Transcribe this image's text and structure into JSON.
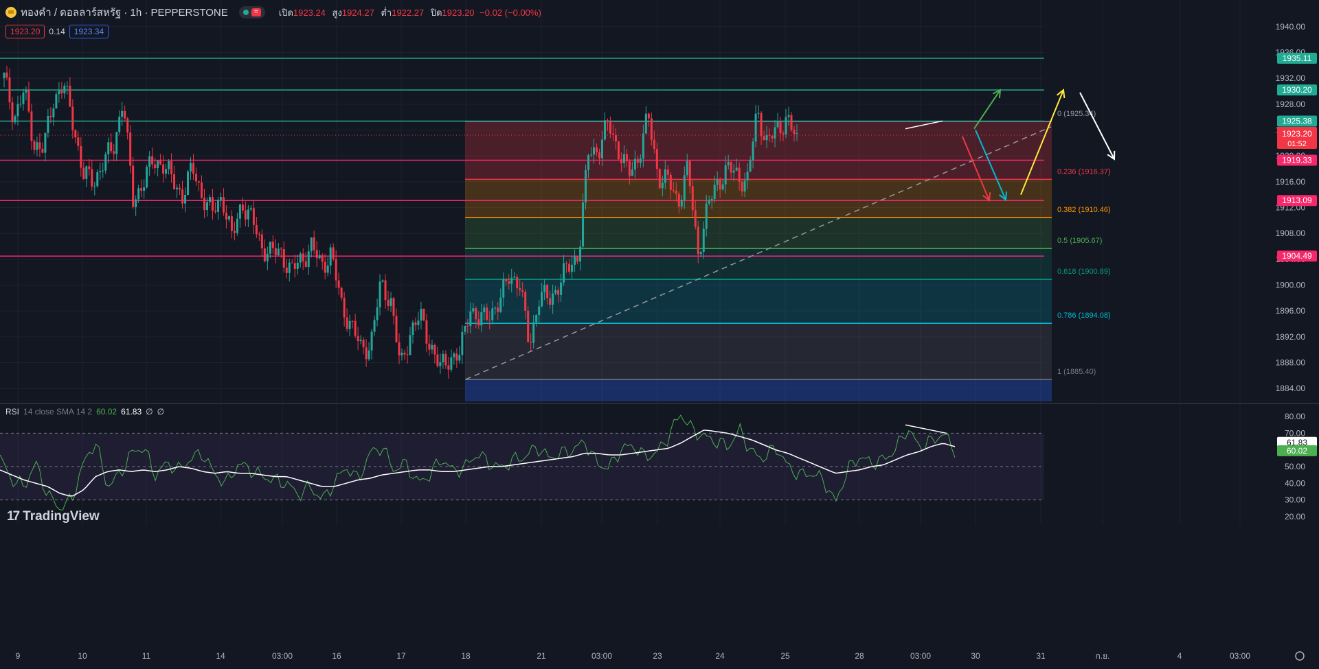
{
  "header": {
    "symbol": "ทองคำ / ดอลลาร์สหรัฐ · 1h · PEPPERSTONE",
    "open_label": "เปิด",
    "open": "1923.24",
    "high_label": "สูง",
    "high": "1924.27",
    "low_label": "ต่ำ",
    "low": "1922.27",
    "close_label": "ปิด",
    "close": "1923.20",
    "change": "−0.02 (−0.00%)",
    "sell": "1923.20",
    "spread": "0.14",
    "buy": "1923.34",
    "status_icon": "green-dot-icon",
    "badge_icon": "equals-icon",
    "badge_text": "="
  },
  "rsi_legend": {
    "name": "RSI",
    "params": "14 close SMA 14 2",
    "value1": "60.02",
    "value2": "61.83",
    "empty1": "∅",
    "empty2": "∅"
  },
  "logo": {
    "text": "TradingView",
    "mark": "17"
  },
  "colors": {
    "bg": "#131722",
    "up": "#26a69a",
    "down": "#f23645",
    "grid": "#1e222d",
    "text": "#b2b5be"
  },
  "chart_data": [
    {
      "type": "candlestick",
      "title": "ทองคำ / ดอลลาร์สหรัฐ · 1h · PEPPERSTONE",
      "ylim": [
        1882,
        1942
      ],
      "y_ticks": [
        "1884.00",
        "1888.00",
        "1892.00",
        "1896.00",
        "1900.00",
        "1904.00",
        "1908.00",
        "1912.00",
        "1916.00",
        "1920.00",
        "1924.00",
        "1928.00",
        "1932.00",
        "1936.00",
        "1940.00"
      ],
      "x_ticks": [
        "9",
        "10",
        "11",
        "14",
        "03:00",
        "16",
        "17",
        "18",
        "21",
        "03:00",
        "23",
        "24",
        "25",
        "28",
        "03:00",
        "30",
        "31",
        "ก.ย.",
        "4",
        "03:00"
      ],
      "price_path": [
        1932,
        1926,
        1930,
        1922,
        1921,
        1929,
        1931,
        1925,
        1917,
        1916,
        1919,
        1921,
        1929,
        1913,
        1916,
        1919,
        1919,
        1916,
        1914,
        1918,
        1914,
        1911,
        1914,
        1907,
        1913,
        1910,
        1906,
        1905,
        1905,
        1902,
        1904,
        1906,
        1903,
        1905,
        1897,
        1894,
        1890,
        1891,
        1900,
        1898,
        1887,
        1893,
        1895,
        1891,
        1887,
        1889,
        1889,
        1897,
        1894,
        1896,
        1897,
        1902,
        1900,
        1891,
        1898,
        1898,
        1900,
        1903,
        1905,
        1921,
        1921,
        1925,
        1921,
        1917,
        1920,
        1926,
        1917,
        1916,
        1913,
        1918,
        1905,
        1912,
        1916,
        1918,
        1917,
        1916,
        1927,
        1922,
        1924,
        1926,
        1922
      ],
      "current_price": "1923.20",
      "countdown": "01:52",
      "horizontal_levels": [
        {
          "price": 1935.11,
          "label": "1935.11",
          "color": "#22ab94"
        },
        {
          "price": 1930.2,
          "label": "1930.20",
          "color": "#22ab94"
        },
        {
          "price": 1925.38,
          "label": "1925.38",
          "color": "#22ab94"
        },
        {
          "price": 1919.33,
          "label": "1919.33",
          "color": "#f7276b"
        },
        {
          "price": 1913.09,
          "label": "1913.09",
          "color": "#f7276b"
        },
        {
          "price": 1904.49,
          "label": "1904.49",
          "color": "#f7276b"
        }
      ],
      "fibonacci": [
        {
          "level": "0",
          "price": 1925.34,
          "label": "0 (1925.34)",
          "color": "#9598a1"
        },
        {
          "level": "0.236",
          "price": 1916.37,
          "label": "0.236 (1916.37)",
          "color": "#f23645"
        },
        {
          "level": "0.382",
          "price": 1910.46,
          "label": "0.382 (1910.46)",
          "color": "#ff9800"
        },
        {
          "level": "0.5",
          "price": 1905.67,
          "label": "0.5 (1905.67)",
          "color": "#4caf50"
        },
        {
          "level": "0.618",
          "price": 1900.89,
          "label": "0.618 (1900.89)",
          "color": "#089981"
        },
        {
          "level": "0.786",
          "price": 1894.08,
          "label": "0.786 (1894.08)",
          "color": "#00bcd4"
        },
        {
          "level": "1",
          "price": 1885.4,
          "label": "1 (1885.40)",
          "color": "#787b86"
        }
      ]
    },
    {
      "type": "line",
      "title": "RSI 14 close SMA 14 2",
      "ylim": [
        15,
        85
      ],
      "y_ticks": [
        "20.00",
        "30.00",
        "40.00",
        "50.00",
        "60.00",
        "70.00",
        "80.00"
      ],
      "bands": [
        30,
        50,
        70
      ],
      "series": [
        {
          "name": "RSI",
          "color": "#4caf50",
          "values": [
            55,
            42,
            38,
            52,
            33,
            25,
            30,
            52,
            65,
            38,
            45,
            58,
            62,
            45,
            52,
            48,
            55,
            58,
            45,
            40,
            52,
            48,
            44,
            42,
            40,
            33,
            38,
            30,
            40,
            50,
            42,
            58,
            62,
            48,
            52,
            40,
            45,
            55,
            47,
            50,
            58,
            52,
            49,
            54,
            56,
            62,
            55,
            58,
            60,
            65,
            52,
            49,
            60,
            63,
            56,
            58,
            68,
            82,
            72,
            68,
            65,
            62,
            72,
            58,
            55,
            62,
            50,
            45,
            46,
            42,
            28,
            48,
            56,
            52,
            54,
            60,
            73,
            62,
            65,
            70,
            60
          ]
        },
        {
          "name": "RSI-based MA",
          "color": "#ffffff",
          "values": [
            48,
            45,
            42,
            40,
            38,
            34,
            32,
            36,
            44,
            47,
            48,
            47,
            48,
            47,
            48,
            50,
            49,
            47,
            46,
            47,
            46,
            46,
            45,
            44,
            44,
            42,
            40,
            38,
            38,
            40,
            42,
            43,
            45,
            46,
            47,
            48,
            48,
            47,
            47,
            48,
            49,
            50,
            50,
            51,
            52,
            53,
            54,
            55,
            56,
            58,
            58,
            57,
            57,
            58,
            59,
            60,
            61,
            64,
            68,
            72,
            71,
            70,
            68,
            66,
            63,
            60,
            58,
            55,
            52,
            49,
            46,
            47,
            48,
            50,
            51,
            54,
            57,
            59,
            62,
            64,
            62
          ]
        }
      ],
      "last_values": [
        {
          "label": "61.83",
          "color": "#ffffff"
        },
        {
          "label": "60.02",
          "color": "#4caf50"
        }
      ]
    }
  ]
}
